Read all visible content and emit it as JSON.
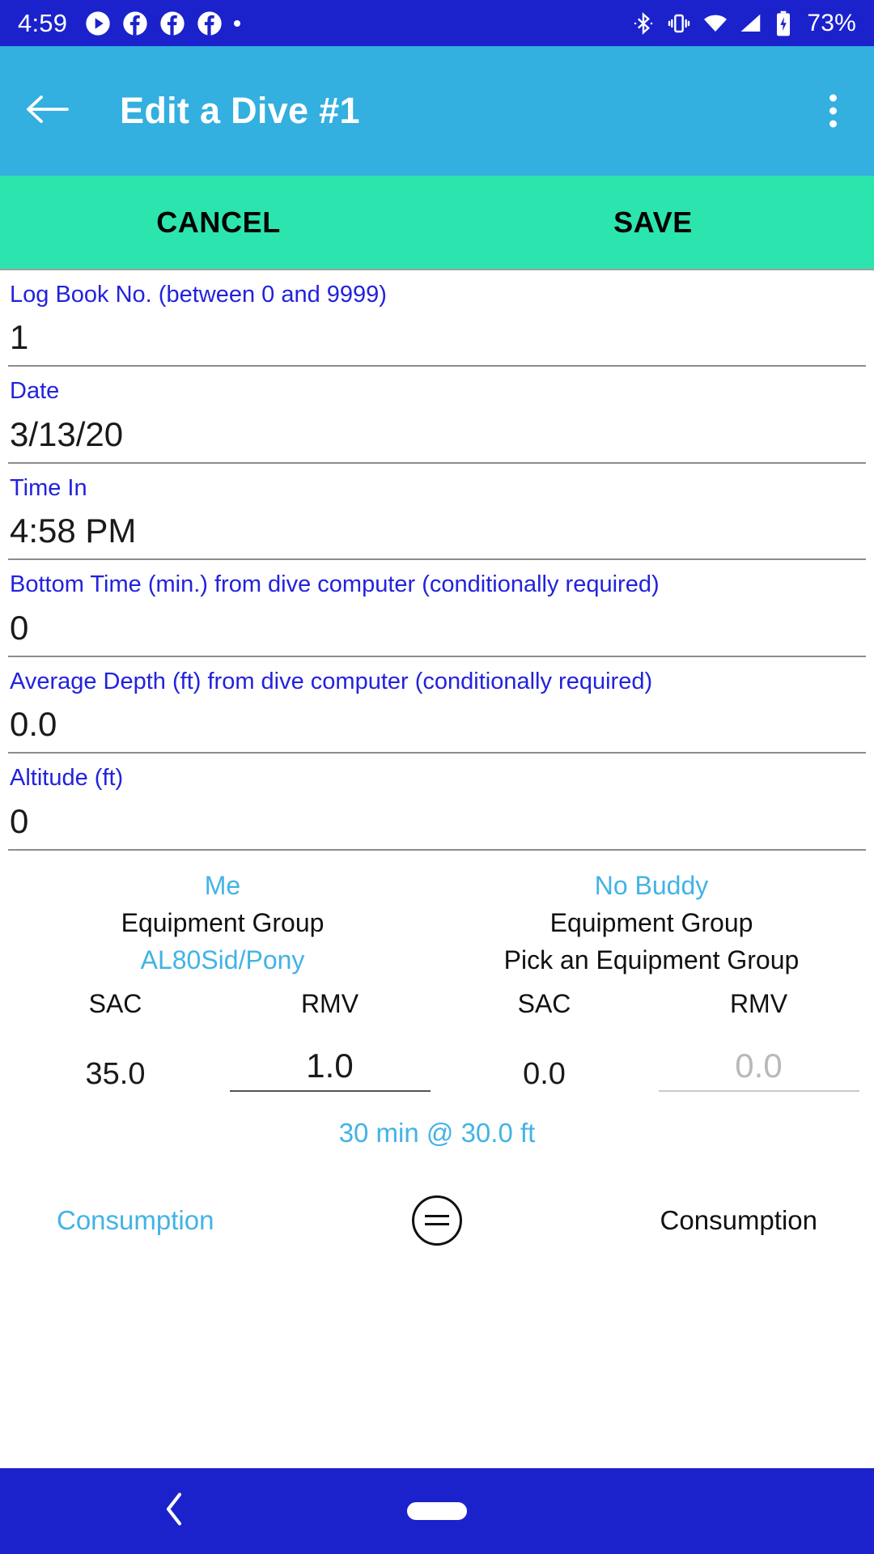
{
  "status_bar": {
    "time": "4:59",
    "battery_percent": "73%",
    "left_icons": [
      "play-circle-icon",
      "facebook-icon",
      "facebook-icon",
      "facebook-icon",
      "dot-icon"
    ],
    "right_icons": [
      "bluetooth-icon",
      "vibrate-icon",
      "wifi-icon",
      "cellular-signal-icon",
      "battery-icon"
    ],
    "background_color": "#1B22CC"
  },
  "app_bar": {
    "title": "Edit a Dive #1",
    "back_icon": "arrow-left-icon",
    "overflow_icon": "more-vertical-icon",
    "background_color": "#33AFE0"
  },
  "action_bar": {
    "cancel_label": "CANCEL",
    "save_label": "SAVE",
    "background_color": "#2CE5AE"
  },
  "form": {
    "label_color": "#2222DD",
    "fields": [
      {
        "label": "Log Book No. (between 0 and 9999)",
        "value": "1"
      },
      {
        "label": "Date",
        "value": "3/13/20"
      },
      {
        "label": "Time In",
        "value": "4:58 PM"
      },
      {
        "label": "Bottom Time (min.) from dive computer (conditionally required)",
        "value": "0"
      },
      {
        "label": "Average Depth (ft) from dive computer (conditionally required)",
        "value": "0.0"
      },
      {
        "label": "Altitude (ft)",
        "value": "0"
      }
    ]
  },
  "compare": {
    "accent_color": "#42B3E5",
    "me": {
      "name": "Me",
      "equipment_label": "Equipment Group",
      "equipment_value": "AL80Sid/Pony",
      "sac_head": "SAC",
      "rmv_head": "RMV",
      "sac_value": "35.0",
      "rmv_value": "1.0",
      "consumption_label": "Consumption"
    },
    "buddy": {
      "name": "No Buddy",
      "equipment_label": "Equipment Group",
      "equipment_value": "Pick an Equipment Group",
      "sac_head": "SAC",
      "rmv_head": "RMV",
      "sac_value": "0.0",
      "rmv_value": "0.0",
      "consumption_label": "Consumption"
    },
    "summary": "30 min @ 30.0 ft",
    "equal_icon": "equals-circle-icon"
  },
  "nav_bar": {
    "back_icon": "chevron-left-icon",
    "home_pill": "home-pill-icon",
    "background_color": "#1B22CC"
  }
}
